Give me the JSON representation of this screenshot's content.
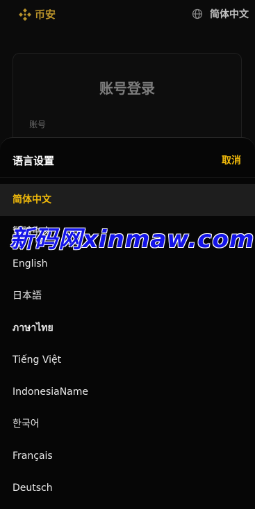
{
  "header": {
    "logo_text": "币安",
    "language_label": "简体中文"
  },
  "login": {
    "title": "账号登录",
    "account_label": "账号"
  },
  "language_sheet": {
    "title": "语言设置",
    "cancel_label": "取消",
    "items": [
      {
        "label": "简体中文",
        "selected": true
      },
      {
        "label": "繁體中文",
        "selected": false
      },
      {
        "label": "English",
        "selected": false
      },
      {
        "label": "日本語",
        "selected": false
      },
      {
        "label": "ภาษาไทย",
        "selected": false
      },
      {
        "label": "Tiếng Việt",
        "selected": false
      },
      {
        "label": "IndonesiaName",
        "selected": false
      },
      {
        "label": "한국어",
        "selected": false
      },
      {
        "label": "Français",
        "selected": false
      },
      {
        "label": "Deutsch",
        "selected": false
      }
    ]
  },
  "watermark": {
    "text": "新码网xinmaw.com"
  },
  "colors": {
    "accent": "#f0b90b",
    "logo": "#b8922a",
    "background": "#0b0b0b",
    "selected_row": "#1e1e1e",
    "watermark": "#1414e8"
  },
  "icons": {
    "logo": "binance-diamond-icon",
    "globe": "globe-icon"
  }
}
